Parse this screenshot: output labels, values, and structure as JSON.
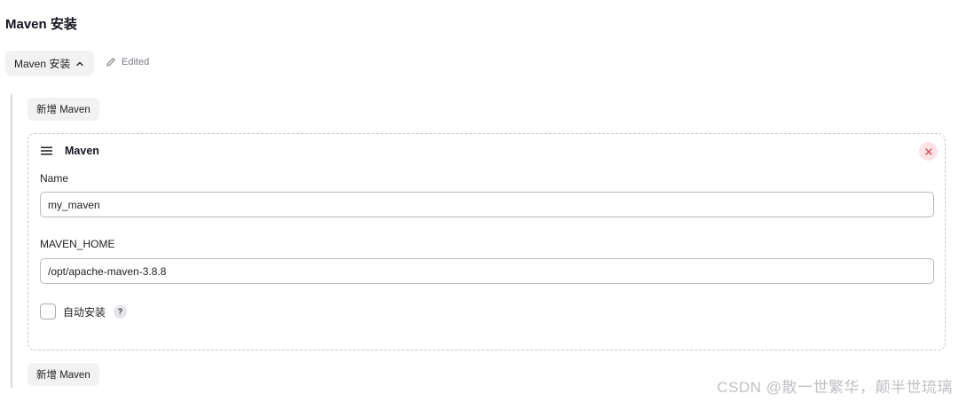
{
  "section": {
    "title": "Maven 安装"
  },
  "collapse_button": {
    "label": "Maven 安装",
    "icon": "chevron-up-icon"
  },
  "edited": {
    "label": "Edited",
    "icon": "pencil-icon"
  },
  "add_button": {
    "label": "新增 Maven"
  },
  "card": {
    "title": "Maven",
    "drag_icon": "drag-handle-icon",
    "delete_icon": "close-icon",
    "name_field": {
      "label": "Name",
      "value": "my_maven"
    },
    "home_field": {
      "label": "MAVEN_HOME",
      "value": "/opt/apache-maven-3.8.8"
    },
    "auto_install": {
      "label": "自动安装",
      "checked": false,
      "help": "?"
    }
  },
  "watermark": {
    "text": "CSDN @散一世繁华，颠半世琉璃"
  },
  "colors": {
    "delete_bg": "#fde3e6",
    "button_bg": "#f2f2f3",
    "border": "#b9b9c0"
  }
}
